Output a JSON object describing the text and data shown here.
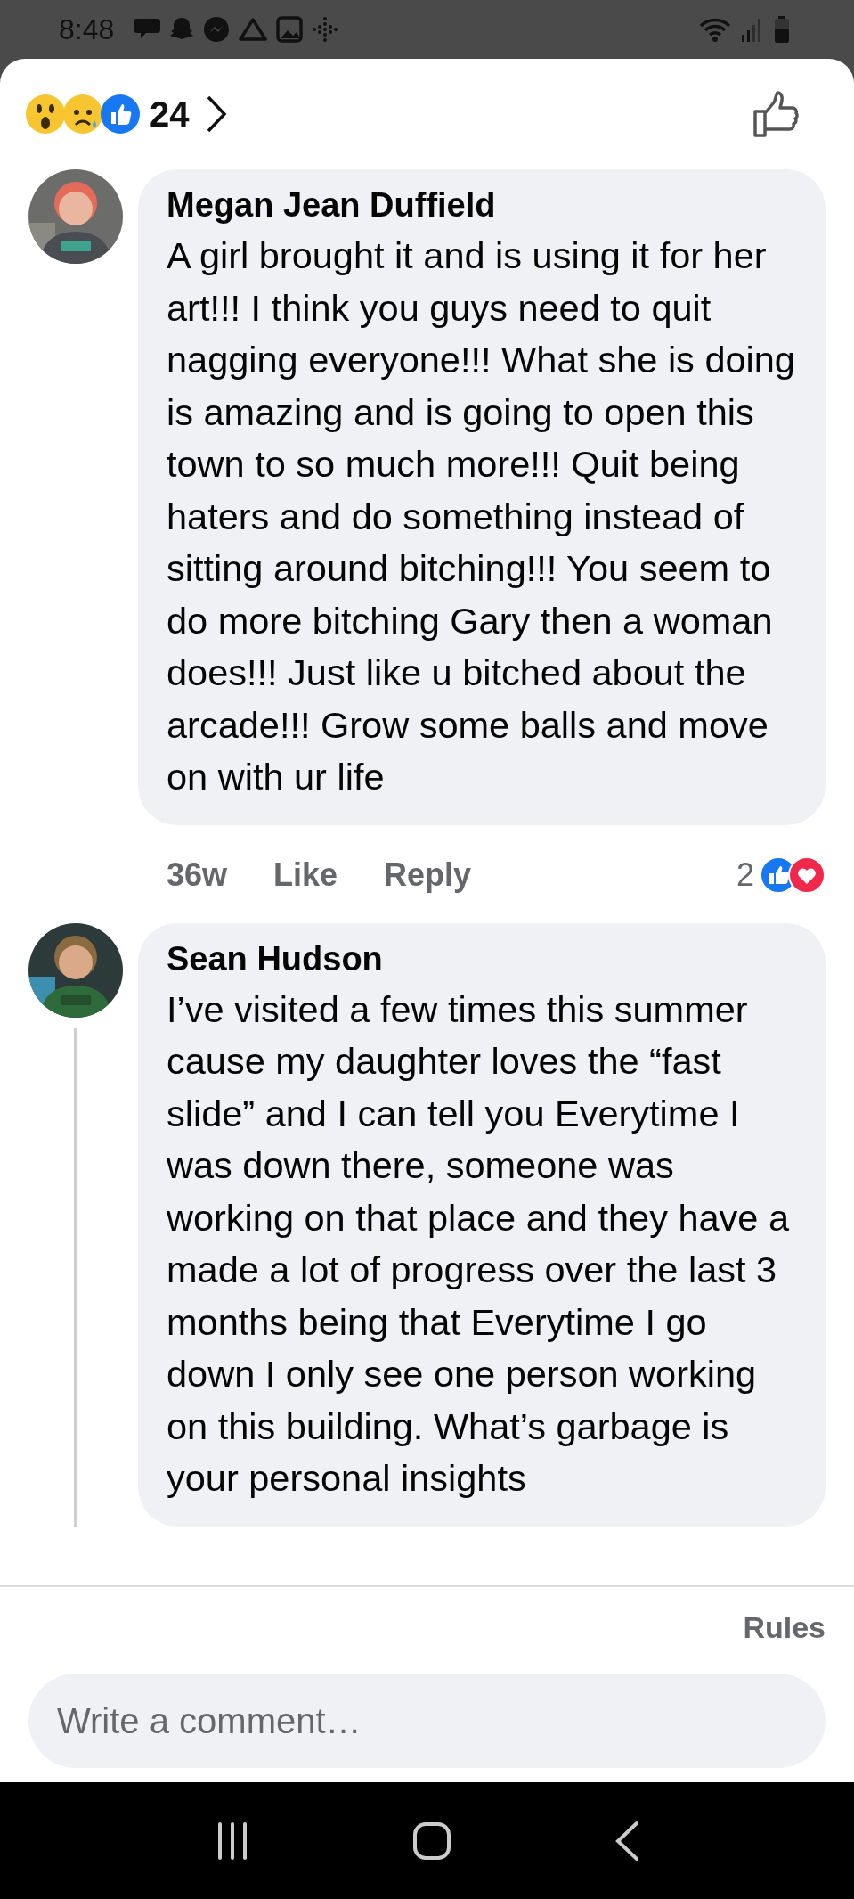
{
  "status_bar": {
    "time": "8:48"
  },
  "reactions": {
    "count": "24"
  },
  "comments": [
    {
      "author": "Megan Jean Duffield",
      "text": "A girl brought it and is using it for her art!!! I think you guys need to quit nagging everyone!!! What she is doing is amazing and is going to open this town to so much more!!! Quit being haters and do something instead of sitting around bitching!!! You seem to do more bitching Gary then a woman does!!! Just like u bitched about the arcade!!! Grow some balls and move on with ur life",
      "time": "36w",
      "like": "Like",
      "reply": "Reply",
      "reaction_count": "2",
      "has_replies": false
    },
    {
      "author": "Sean Hudson",
      "text": "I’ve visited a few times this summer cause my daughter loves the “fast slide” and I can tell you Everytime I was down there, someone was working on that place and they have a made a lot of progress over the last 3 months being that Everytime I go down I only see one person working on this building. What’s garbage is your personal insights",
      "has_replies": true
    }
  ],
  "footer": {
    "rules": "Rules",
    "comment_field": {
      "placeholder": "Write a comment…"
    }
  }
}
